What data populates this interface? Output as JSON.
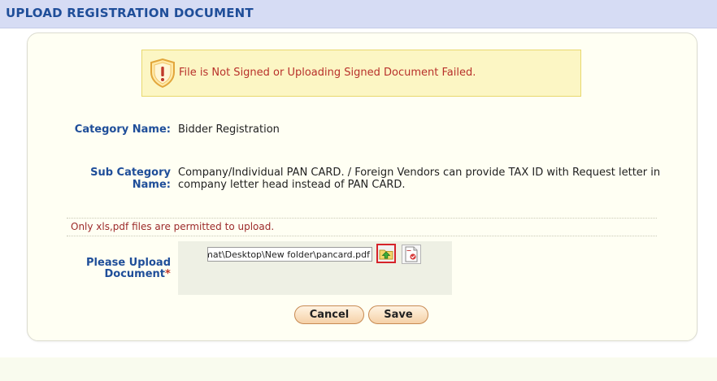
{
  "header": {
    "title": "UPLOAD REGISTRATION DOCUMENT"
  },
  "alert": {
    "icon": "warning-shield-icon",
    "message": "File is Not Signed or Uploading Signed Document Failed."
  },
  "form": {
    "category_label": "Category Name:",
    "category_value": "Bidder Registration",
    "subcategory_label_1": "Sub Category",
    "subcategory_label_2": "Name:",
    "subcategory_value_1": "Company/Individual PAN CARD. / Foreign Vendors can provide TAX ID with Request letter in",
    "subcategory_value_2": "company letter head instead of PAN CARD.",
    "note": "Only xls,pdf files are permitted to upload.",
    "upload_label_1": "Please Upload",
    "upload_label_2": "Document",
    "required_marker": "*",
    "file_value": "s\\sumat\\Desktop\\New folder\\pancard.pdf"
  },
  "buttons": {
    "cancel_label": "Cancel",
    "save_label": "Save"
  },
  "colors": {
    "header_bg": "#d6dcf4",
    "title_blue": "#1f4e99",
    "alert_bg": "#fcf6c4",
    "alert_text": "#b8312b",
    "button_border": "#c78a52"
  }
}
